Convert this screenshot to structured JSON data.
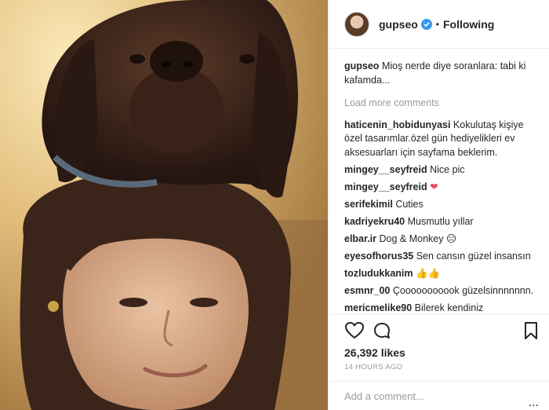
{
  "post": {
    "username": "gupseo",
    "verified": true,
    "follow_status": "Following",
    "separator": "•",
    "caption": "Mioş nerde diye soranlara: tabi ki kafamda...",
    "load_more": "Load more comments",
    "likes": "26,392 likes",
    "time": "14 HOURS AGO",
    "add_comment_placeholder": "Add a comment...",
    "more_menu": "..."
  },
  "comments": [
    {
      "user": "haticenin_hobidunyasi",
      "text": "Kokulutaş kişiye özel tasarımlar.özel gün hediyelikleri ev aksesuarları için sayfama beklerim."
    },
    {
      "user": "mingey__seyfreid",
      "text": "Nice pic"
    },
    {
      "user": "mingey__seyfreid",
      "text": "❤"
    },
    {
      "user": "serifekimil",
      "text": "Cuties"
    },
    {
      "user": "kadriyekru40",
      "text": "Musmutlu yıllar"
    },
    {
      "user": "elbar.ir",
      "text": "Dog & Monkey 😑"
    },
    {
      "user": "eyesofhorus35",
      "text": "Sen cansın güzel insansın"
    },
    {
      "user": "tozludukkanim",
      "text": "👍👍"
    },
    {
      "user": "esmnr_00",
      "text": "Çooooooooook güzelsinnnnnnn."
    },
    {
      "user": "mericmelike90",
      "text": "Bilerek kendiniz yapiyorsunuz. Baydi hep ayni şekilde."
    }
  ],
  "icons": {
    "like": "heart-icon",
    "comment": "comment-bubble-icon",
    "save": "bookmark-icon",
    "verified": "verified-badge-icon"
  },
  "colors": {
    "accent": "#3897f0",
    "muted": "#999999",
    "text": "#262626",
    "heart": "#ed4956"
  }
}
